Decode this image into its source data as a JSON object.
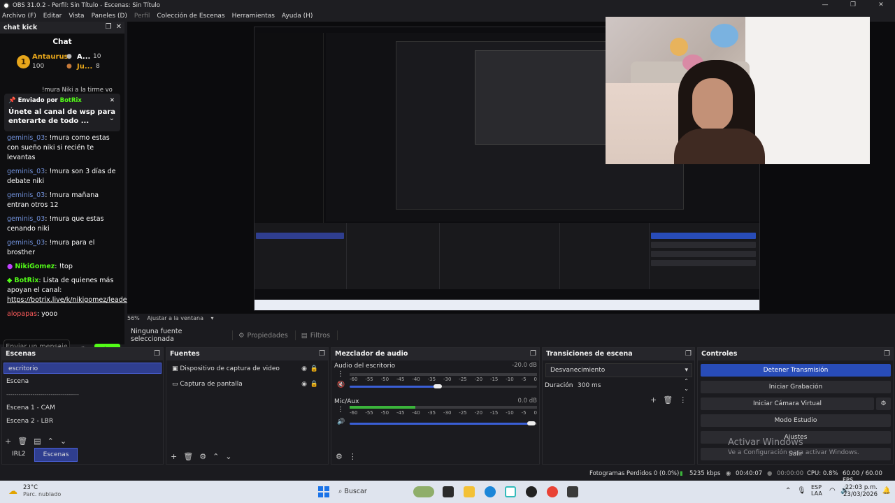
{
  "window": {
    "title": "OBS 31.0.2 - Perfil: Sin Título - Escenas: Sin Título",
    "controls": [
      "—",
      "❐",
      "✕"
    ]
  },
  "menu": [
    "Archivo (F)",
    "Editar",
    "Vista",
    "Paneles (D)",
    "Perfil",
    "Colección de Escenas",
    "Herramientas",
    "Ayuda (H)"
  ],
  "chat_dock": {
    "title": "chat kick",
    "header": "Chat",
    "leader1": {
      "name": "Antaurus",
      "points": "100"
    },
    "leader2": {
      "name": "A...",
      "points": "10"
    },
    "leader3": {
      "name": "Ju...",
      "points": "8"
    },
    "partial_msg": "!mura Niki a la tirme vo",
    "pinned_by_label": "Enviado por",
    "pinned_by": "BotRix",
    "pinned_msg": "Únete al canal de wsp para enterarte de todo",
    "pinned_more": "...",
    "messages": [
      {
        "user": "geminis_03",
        "text": ": !mura como estas con sueño niki si recién te levantas"
      },
      {
        "user": "geminis_03",
        "text": ": !mura son 3 días de debate niki"
      },
      {
        "user": "geminis_03",
        "text": ": !mura mañana entran otros 12"
      },
      {
        "user": "geminis_03",
        "text": ": !mura que estas cenando niki"
      },
      {
        "user": "geminis_03",
        "text": ": !mura para el brosther"
      }
    ],
    "niki_msg": {
      "user": "NikiGomez",
      "text": ": !top"
    },
    "botrix_msg": {
      "user": "BotRix",
      "text": ": Lista de quienes más apoyan el canal:",
      "link": "https://botrix.live/k/nikigomez/leaderboard"
    },
    "last_msg": {
      "user": "alopapas",
      "text": ": yooo"
    },
    "input_placeholder": "Enviar un mensaje",
    "send_label": "Chat"
  },
  "preview": {
    "zoom": "56%",
    "fit_label": "Ajustar a la ventana"
  },
  "source_toolbar": {
    "no_source": "Ninguna fuente seleccionada",
    "properties": "Propiedades",
    "filters": "Filtros"
  },
  "scenes": {
    "title": "Escenas",
    "items": [
      "escritorio",
      "Escena",
      "------------------------------------",
      "Escena 1 - CAM",
      "Escena 2 - LBR"
    ],
    "tabs": [
      "IRL2",
      "Escenas"
    ]
  },
  "sources": {
    "title": "Fuentes",
    "items": [
      "Dispositivo de captura de video",
      "Captura de pantalla"
    ]
  },
  "mixer": {
    "title": "Mezclador de audio",
    "tracks": [
      {
        "name": "Audio del escritorio",
        "db": "-20.0 dB",
        "volume": 0.47,
        "level": 0
      },
      {
        "name": "Mic/Aux",
        "db": "0.0 dB",
        "volume": 0.97,
        "level": 0.35
      }
    ],
    "ticks": [
      "-60",
      "-55",
      "-50",
      "-45",
      "-40",
      "-35",
      "-30",
      "-25",
      "-20",
      "-15",
      "-10",
      "-5",
      "0"
    ]
  },
  "transitions": {
    "title": "Transiciones de escena",
    "type": "Desvanecimiento",
    "duration_label": "Duración",
    "duration_value": "300 ms"
  },
  "controls": {
    "title": "Controles",
    "buttons": [
      "Detener Transmisión",
      "Iniciar Grabación",
      "Iniciar Cámara Virtual",
      "Modo Estudio",
      "Ajustes",
      "Salir"
    ]
  },
  "watermark": {
    "line1": "Activar Windows",
    "line2": "Ve a Configuración para activar Windows."
  },
  "status": {
    "dropped": "Fotogramas Perdidos 0 (0.0%)",
    "bitrate": "5235 kbps",
    "stream_time": "00:40:07",
    "rec_time": "00:00:00",
    "cpu": "CPU: 0.8%",
    "fps": "60.00 / 60.00 FPS"
  },
  "taskbar": {
    "temp": "23°C",
    "weather": "Parc. nublado",
    "search": "Buscar",
    "lang1": "ESP",
    "lang2": "LAA",
    "time": "22:03 p.m.",
    "date": "23/03/2026"
  },
  "colors": {
    "kick_green": "#53fc18",
    "obs_blue": "#284cb8",
    "gold": "#e7a61b"
  }
}
